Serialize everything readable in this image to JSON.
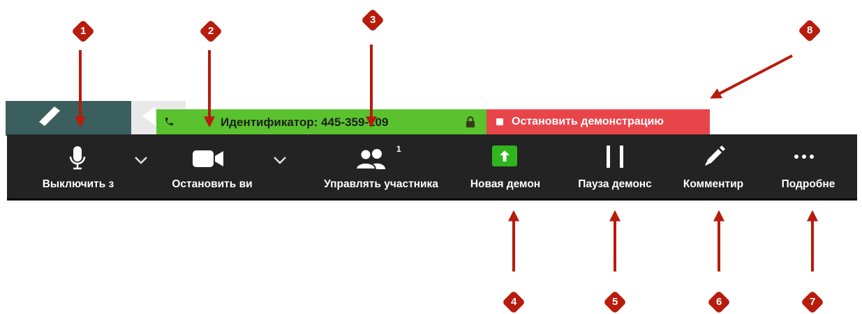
{
  "share_bar": {
    "meeting_id_text": "Идентификатор: 445-359-109",
    "stop_share_label": "Остановить демонстрацию"
  },
  "toolbar": {
    "items": [
      {
        "label": "Выключить з",
        "icon": "microphone-icon"
      },
      {
        "label": "Остановить ви",
        "icon": "video-camera-icon"
      },
      {
        "label": "Управлять участника",
        "icon": "participants-icon",
        "badge": "1"
      },
      {
        "label": "Новая демон",
        "icon": "new-share-icon"
      },
      {
        "label": "Пауза демонс",
        "icon": "pause-icon"
      },
      {
        "label": "Комментир",
        "icon": "pencil-icon"
      },
      {
        "label": "Подробне",
        "icon": "more-dots-icon"
      }
    ]
  },
  "markers": [
    "1",
    "2",
    "3",
    "4",
    "5",
    "6",
    "7",
    "8"
  ],
  "colors": {
    "toolbar_bg": "#232323",
    "green": "#5ac22e",
    "red": "#e8454b",
    "arrow": "#b71c0c"
  }
}
